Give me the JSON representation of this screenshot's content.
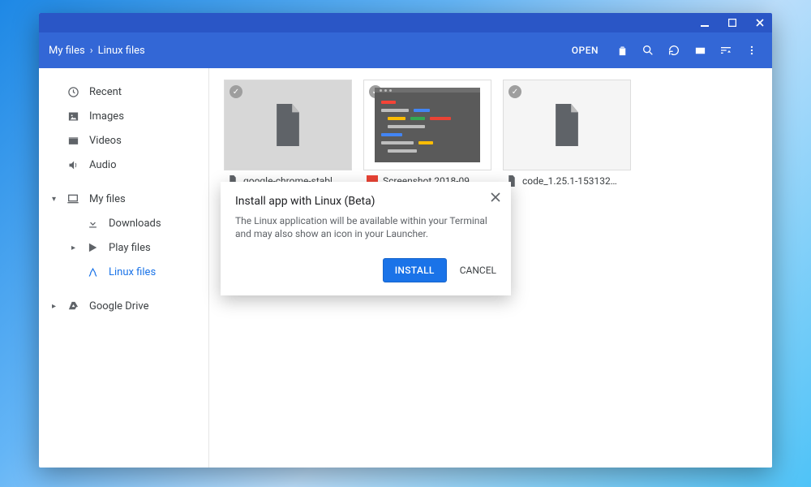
{
  "breadcrumb": {
    "root": "My files",
    "current": "Linux files"
  },
  "toolbar": {
    "open": "OPEN"
  },
  "sidebar": {
    "items": [
      {
        "label": "Recent"
      },
      {
        "label": "Images"
      },
      {
        "label": "Videos"
      },
      {
        "label": "Audio"
      },
      {
        "label": "My files"
      },
      {
        "label": "Downloads"
      },
      {
        "label": "Play files"
      },
      {
        "label": "Linux files"
      },
      {
        "label": "Google Drive"
      }
    ]
  },
  "files": [
    {
      "name": "google-chrome-stabl…"
    },
    {
      "name": "Screenshot 2018-09…"
    },
    {
      "name": "code_1.25.1-153132…"
    }
  ],
  "dialog": {
    "title": "Install app with Linux (Beta)",
    "body": "The Linux application will be available within your Terminal and may also show an icon in your Launcher.",
    "install": "INSTALL",
    "cancel": "CANCEL"
  }
}
